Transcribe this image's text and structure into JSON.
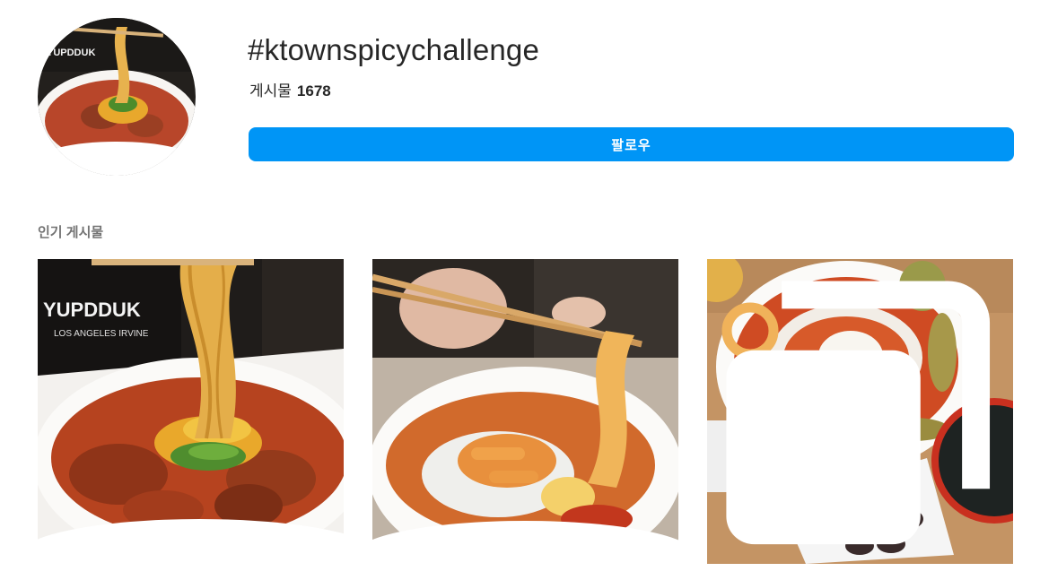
{
  "header": {
    "hashtag": "#ktownspicychallenge",
    "posts_label": "게시물",
    "posts_count": "1678",
    "follow_label": "팔로우",
    "avatar_image": "profile-thumbnail-tteokbokki"
  },
  "top_posts": {
    "label": "인기 게시물",
    "items": [
      {
        "image": "tteokbokki-noodle-lift-bowl",
        "sign_text": "YUPDDUK",
        "sign_subtext": "LOS ANGELES IRVINE",
        "multi": false
      },
      {
        "image": "rose-tteokbokki-chopsticks",
        "multi": false
      },
      {
        "image": "tteokbokki-egg-sundae-table",
        "multi": true,
        "multi_icon": "multiple-posts-icon"
      }
    ]
  },
  "colors": {
    "accent": "#0095f6",
    "text": "#262626",
    "muted": "#737373"
  }
}
